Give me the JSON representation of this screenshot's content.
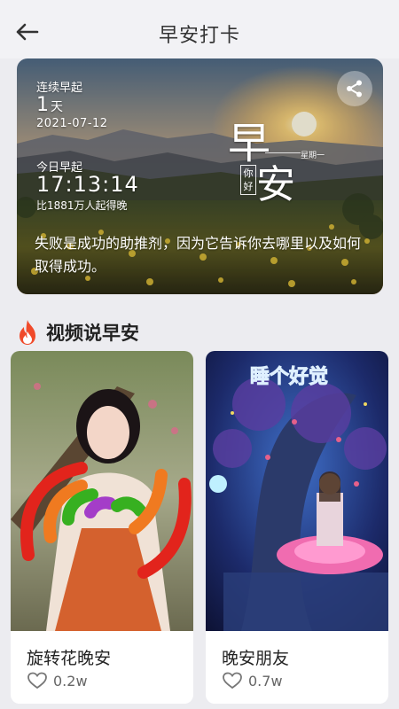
{
  "header": {
    "title": "早安打卡"
  },
  "hero": {
    "streak_label": "连续早起",
    "streak_value": "1",
    "streak_unit": "天",
    "streak_date": "2021-07-12",
    "today_label": "今日早起",
    "wake_time": "17:13:14",
    "compare_text": "比1881万人起得晚",
    "quote": "失败是成功的助推剂，因为它告诉你去哪里以及如何取得成功。",
    "calligraphy": {
      "zao": "早",
      "an": "安",
      "weekday": "星期一",
      "nihao": "你好"
    }
  },
  "section": {
    "title": "视频说早安",
    "icon": "fire-icon"
  },
  "videos": [
    {
      "title": "旋转花晚安",
      "likes": "0.2w",
      "icon": "heart-icon"
    },
    {
      "title": "晚安朋友",
      "likes": "0.7w",
      "icon": "heart-icon",
      "overlay_text": "睡个好觉"
    }
  ],
  "colors": {
    "accent_fire": "#f04a2a",
    "background": "#ececf0"
  }
}
